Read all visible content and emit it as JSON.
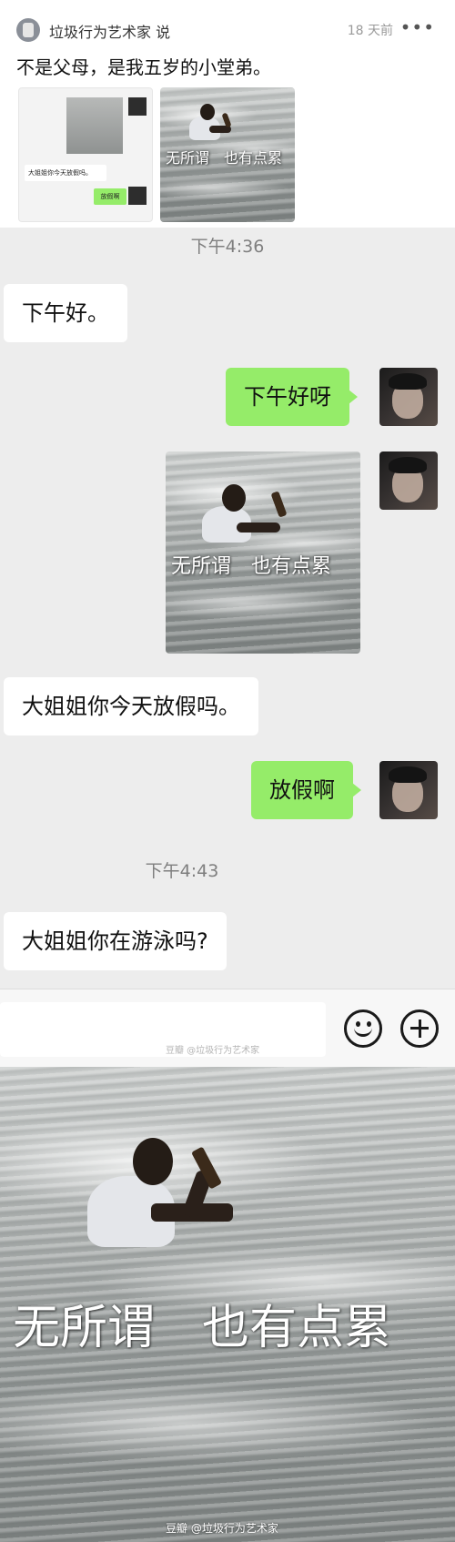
{
  "post": {
    "author": "垃圾行为艺术家 说",
    "time": "18 天前",
    "more": "•••",
    "text": "不是父母，是我五岁的小堂弟。",
    "thumb_chat": {
      "bubble_left": "大姐姐你今天放假吗。",
      "bubble_right": "放假啊"
    },
    "thumb_photo_caption": "无所谓　也有点累"
  },
  "chat": {
    "timestamp_1": "下午4:36",
    "msg_1": "下午好。",
    "msg_2": "下午好呀",
    "sticker_caption": "无所谓　也有点累",
    "msg_3": "大姐姐你今天放假吗。",
    "msg_4": "放假啊",
    "timestamp_2": "下午4:43",
    "msg_5": "大姐姐你在游泳吗?"
  },
  "input_bar": {
    "emoji_icon": "smiley-icon",
    "plus_icon": "plus-icon",
    "watermark": "豆瓣 @垃圾行为艺术家"
  },
  "big_meme": {
    "caption": "无所谓　也有点累",
    "watermark": "豆瓣 @垃圾行为艺术家"
  },
  "colors": {
    "chat_bg": "#ededed",
    "bubble_mine": "#95ec69",
    "bubble_theirs": "#ffffff"
  }
}
